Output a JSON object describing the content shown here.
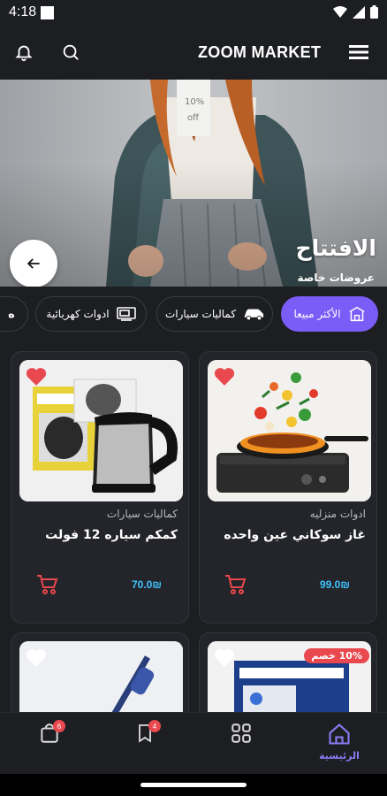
{
  "status": {
    "time": "4:18"
  },
  "header": {
    "title": "ZOOM MARKET"
  },
  "banner": {
    "title": "الافتتاح",
    "subtitle": "عروضات خاصة",
    "tag_line1": "10%",
    "tag_line2": "off"
  },
  "categories": [
    {
      "label": "الأكثر مبيعا",
      "icon": "store-icon",
      "active": true
    },
    {
      "label": "كماليات سيارات",
      "icon": "car-icon",
      "active": false
    },
    {
      "label": "ادوات كهربائية",
      "icon": "tv-icon",
      "active": false
    }
  ],
  "products": [
    {
      "category": "ادوات منزليه",
      "name": "غاز سوكاني عين واحده",
      "price": "99.0₪",
      "favorite": true
    },
    {
      "category": "كماليات سيارات",
      "name": "كمكم سياره 12 فولت",
      "price": "70.0₪",
      "favorite": true
    },
    {
      "discount": "10% خصم",
      "favorite": false
    },
    {
      "favorite": false
    }
  ],
  "nav": {
    "home_label": "الرئيسية",
    "saved_badge": "4",
    "cart_badge": "6"
  },
  "colors": {
    "accent": "#7a5cf6",
    "price": "#3ec3ff",
    "heart": "#e8484e",
    "background": "#1d1e22"
  }
}
